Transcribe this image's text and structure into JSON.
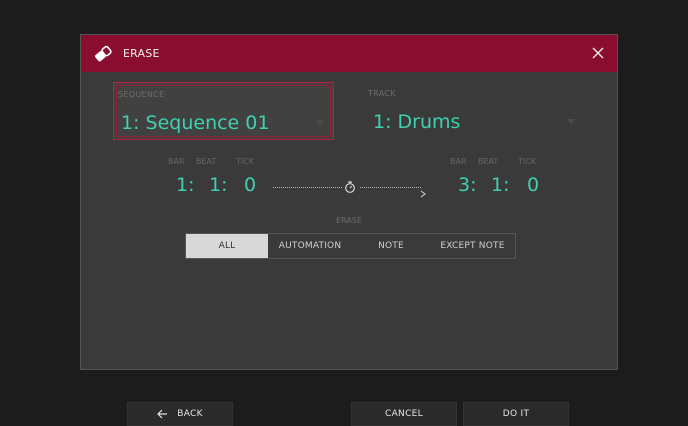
{
  "dialog": {
    "title": "ERASE",
    "icon": "eraser-icon",
    "close_icon": "close-icon"
  },
  "sequence": {
    "label": "SEQUENCE",
    "value": "1: Sequence 01"
  },
  "track": {
    "label": "TRACK",
    "value": "1: Drums"
  },
  "time_range": {
    "start": {
      "labels": [
        "BAR",
        "BEAT",
        "TICK"
      ],
      "bar": "1:",
      "beat": "1:",
      "tick": "0"
    },
    "end": {
      "labels": [
        "BAR",
        "BEAT",
        "TICK"
      ],
      "bar": "3:",
      "beat": "1:",
      "tick": "0"
    },
    "separator_icon": "stopwatch-icon"
  },
  "erase": {
    "label": "ERASE",
    "options": [
      "ALL",
      "AUTOMATION",
      "NOTE",
      "EXCEPT NOTE"
    ],
    "selected": "ALL"
  },
  "bottom_bar": {
    "back_label": "BACK",
    "cancel_label": "CANCEL",
    "doit_label": "DO IT"
  },
  "colors": {
    "header": "#8a0c2e",
    "accent": "#3fd0b0",
    "selection_border": "#b8203f"
  }
}
